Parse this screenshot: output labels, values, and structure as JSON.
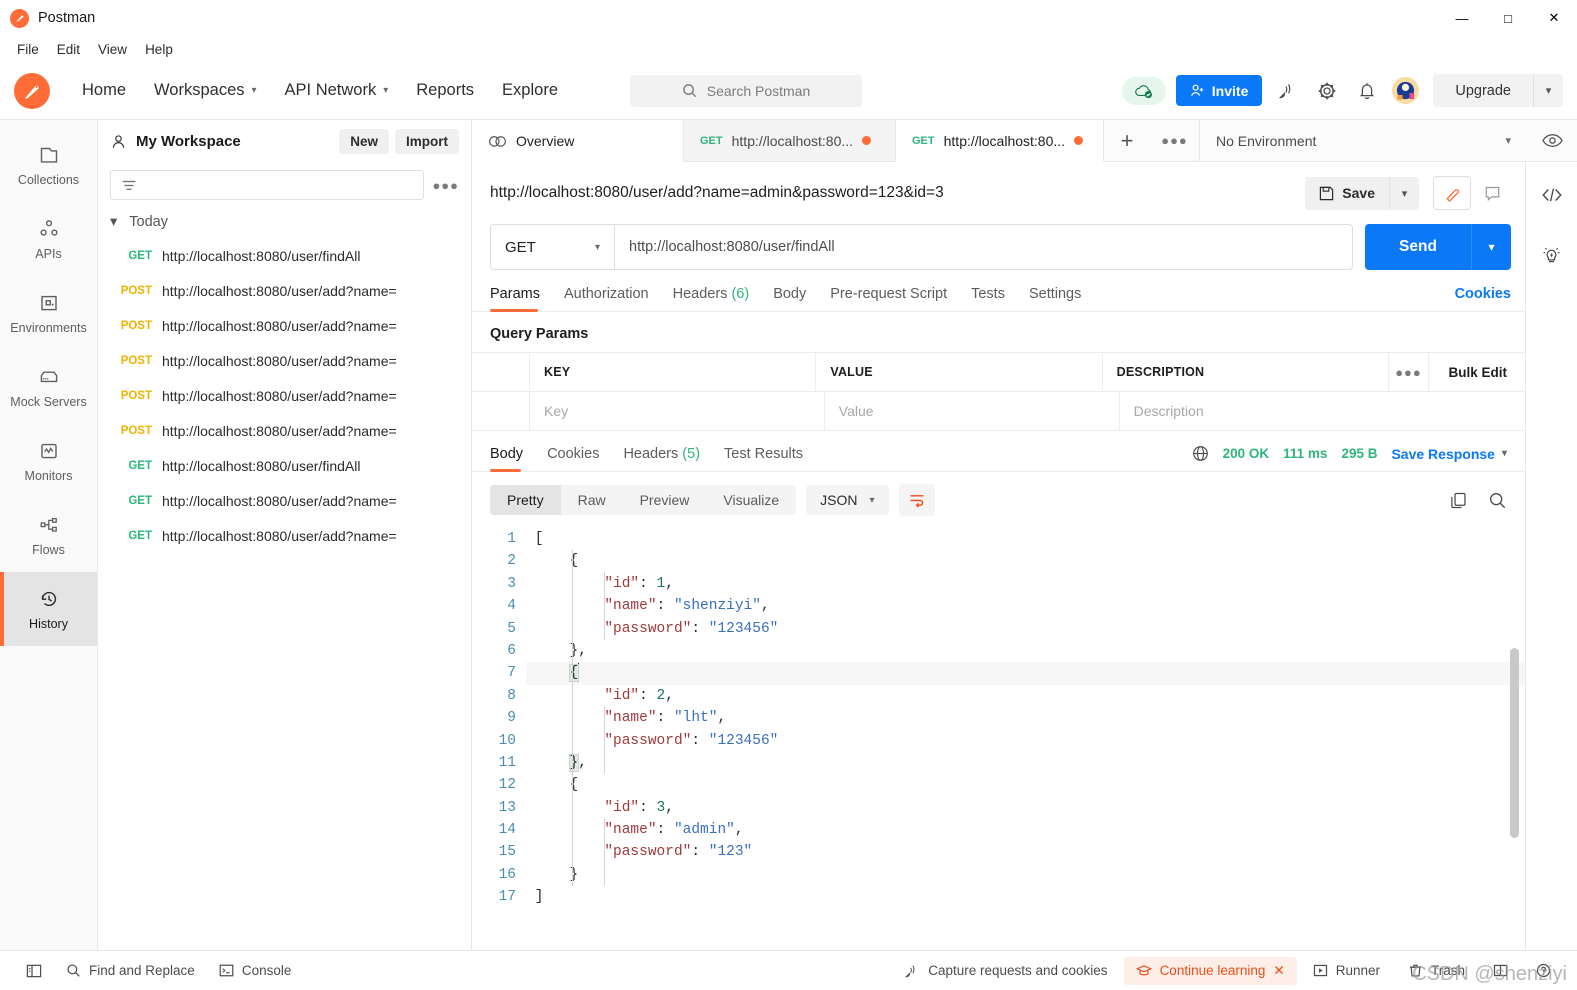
{
  "window": {
    "app_title": "Postman",
    "controls": {
      "minimize": "—",
      "maximize": "□",
      "close": "✕"
    }
  },
  "menubar": {
    "items": [
      "File",
      "Edit",
      "View",
      "Help"
    ]
  },
  "header": {
    "nav": [
      {
        "label": "Home",
        "has_caret": false
      },
      {
        "label": "Workspaces",
        "has_caret": true
      },
      {
        "label": "API Network",
        "has_caret": true
      },
      {
        "label": "Reports",
        "has_caret": false
      },
      {
        "label": "Explore",
        "has_caret": false
      }
    ],
    "search_placeholder": "Search Postman",
    "invite_label": "Invite",
    "upgrade_label": "Upgrade",
    "icons": [
      "cloud-sync-icon",
      "satellite-icon",
      "gear-icon",
      "bell-icon",
      "avatar"
    ]
  },
  "rail": {
    "items": [
      {
        "label": "Collections",
        "icon": "collections-icon",
        "active": false
      },
      {
        "label": "APIs",
        "icon": "apis-icon",
        "active": false
      },
      {
        "label": "Environments",
        "icon": "environments-icon",
        "active": false
      },
      {
        "label": "Mock Servers",
        "icon": "mock-servers-icon",
        "active": false
      },
      {
        "label": "Monitors",
        "icon": "monitors-icon",
        "active": false
      },
      {
        "label": "Flows",
        "icon": "flows-icon",
        "active": false
      },
      {
        "label": "History",
        "icon": "history-icon",
        "active": true
      }
    ]
  },
  "sidebar": {
    "workspace_name": "My Workspace",
    "new_label": "New",
    "import_label": "Import",
    "filter_placeholder": "",
    "group_label": "Today",
    "history": [
      {
        "method": "GET",
        "url": "http://localhost:8080/user/findAll"
      },
      {
        "method": "POST",
        "url": "http://localhost:8080/user/add?name="
      },
      {
        "method": "POST",
        "url": "http://localhost:8080/user/add?name="
      },
      {
        "method": "POST",
        "url": "http://localhost:8080/user/add?name="
      },
      {
        "method": "POST",
        "url": "http://localhost:8080/user/add?name="
      },
      {
        "method": "POST",
        "url": "http://localhost:8080/user/add?name="
      },
      {
        "method": "GET",
        "url": "http://localhost:8080/user/findAll"
      },
      {
        "method": "GET",
        "url": "http://localhost:8080/user/add?name="
      },
      {
        "method": "GET",
        "url": "http://localhost:8080/user/add?name="
      }
    ]
  },
  "tabbar": {
    "overview_label": "Overview",
    "tabs": [
      {
        "method": "GET",
        "name": "http://localhost:80...",
        "unsaved": true,
        "active": false
      },
      {
        "method": "GET",
        "name": "http://localhost:80...",
        "unsaved": true,
        "active": true
      }
    ],
    "environment": "No Environment"
  },
  "request": {
    "title": "http://localhost:8080/user/add?name=admin&password=123&id=3",
    "save_label": "Save",
    "method": "GET",
    "url": "http://localhost:8080/user/findAll",
    "send_label": "Send",
    "tabs": [
      {
        "label": "Params",
        "count": "",
        "active": true
      },
      {
        "label": "Authorization",
        "count": "",
        "active": false
      },
      {
        "label": "Headers",
        "count": "(6)",
        "active": false
      },
      {
        "label": "Body",
        "count": "",
        "active": false
      },
      {
        "label": "Pre-request Script",
        "count": "",
        "active": false
      },
      {
        "label": "Tests",
        "count": "",
        "active": false
      },
      {
        "label": "Settings",
        "count": "",
        "active": false
      }
    ],
    "cookies_label": "Cookies",
    "query_params_title": "Query Params",
    "params_table": {
      "headers": [
        "KEY",
        "VALUE",
        "DESCRIPTION"
      ],
      "bulk_edit_label": "Bulk Edit",
      "placeholders": [
        "Key",
        "Value",
        "Description"
      ]
    }
  },
  "response": {
    "tabs": [
      {
        "label": "Body",
        "count": "",
        "active": true
      },
      {
        "label": "Cookies",
        "count": "",
        "active": false
      },
      {
        "label": "Headers",
        "count": "(5)",
        "active": false
      },
      {
        "label": "Test Results",
        "count": "",
        "active": false
      }
    ],
    "status": "200 OK",
    "time": "111 ms",
    "size": "295 B",
    "save_response_label": "Save Response",
    "view_modes": [
      "Pretty",
      "Raw",
      "Preview",
      "Visualize"
    ],
    "active_view_mode": "Pretty",
    "format": "JSON",
    "body_lines": [
      {
        "n": 1,
        "indent": 0,
        "tokens": [
          {
            "t": "punc",
            "v": "["
          }
        ]
      },
      {
        "n": 2,
        "indent": 1,
        "tokens": [
          {
            "t": "brace",
            "v": "{"
          }
        ]
      },
      {
        "n": 3,
        "indent": 2,
        "tokens": [
          {
            "t": "key",
            "v": "\"id\""
          },
          {
            "t": "punc",
            "v": ": "
          },
          {
            "t": "num",
            "v": "1"
          },
          {
            "t": "punc",
            "v": ","
          }
        ]
      },
      {
        "n": 4,
        "indent": 2,
        "tokens": [
          {
            "t": "key",
            "v": "\"name\""
          },
          {
            "t": "punc",
            "v": ": "
          },
          {
            "t": "str",
            "v": "\"shenziyi\""
          },
          {
            "t": "punc",
            "v": ","
          }
        ]
      },
      {
        "n": 5,
        "indent": 2,
        "tokens": [
          {
            "t": "key",
            "v": "\"password\""
          },
          {
            "t": "punc",
            "v": ": "
          },
          {
            "t": "str",
            "v": "\"123456\""
          }
        ]
      },
      {
        "n": 6,
        "indent": 1,
        "tokens": [
          {
            "t": "brace",
            "v": "}"
          },
          {
            "t": "punc",
            "v": ","
          }
        ]
      },
      {
        "n": 7,
        "indent": 1,
        "tokens": [
          {
            "t": "brace-hl",
            "v": "{"
          },
          {
            "t": "caret",
            "v": ""
          }
        ]
      },
      {
        "n": 8,
        "indent": 2,
        "tokens": [
          {
            "t": "key",
            "v": "\"id\""
          },
          {
            "t": "punc",
            "v": ": "
          },
          {
            "t": "num",
            "v": "2"
          },
          {
            "t": "punc",
            "v": ","
          }
        ]
      },
      {
        "n": 9,
        "indent": 2,
        "tokens": [
          {
            "t": "key",
            "v": "\"name\""
          },
          {
            "t": "punc",
            "v": ": "
          },
          {
            "t": "str",
            "v": "\"lht\""
          },
          {
            "t": "punc",
            "v": ","
          }
        ]
      },
      {
        "n": 10,
        "indent": 2,
        "tokens": [
          {
            "t": "key",
            "v": "\"password\""
          },
          {
            "t": "punc",
            "v": ": "
          },
          {
            "t": "str",
            "v": "\"123456\""
          }
        ]
      },
      {
        "n": 11,
        "indent": 1,
        "tokens": [
          {
            "t": "brace-hl",
            "v": "}"
          },
          {
            "t": "punc",
            "v": ","
          }
        ]
      },
      {
        "n": 12,
        "indent": 1,
        "tokens": [
          {
            "t": "brace",
            "v": "{"
          }
        ]
      },
      {
        "n": 13,
        "indent": 2,
        "tokens": [
          {
            "t": "key",
            "v": "\"id\""
          },
          {
            "t": "punc",
            "v": ": "
          },
          {
            "t": "num",
            "v": "3"
          },
          {
            "t": "punc",
            "v": ","
          }
        ]
      },
      {
        "n": 14,
        "indent": 2,
        "tokens": [
          {
            "t": "key",
            "v": "\"name\""
          },
          {
            "t": "punc",
            "v": ": "
          },
          {
            "t": "str",
            "v": "\"admin\""
          },
          {
            "t": "punc",
            "v": ","
          }
        ]
      },
      {
        "n": 15,
        "indent": 2,
        "tokens": [
          {
            "t": "key",
            "v": "\"password\""
          },
          {
            "t": "punc",
            "v": ": "
          },
          {
            "t": "str",
            "v": "\"123\""
          }
        ]
      },
      {
        "n": 16,
        "indent": 1,
        "tokens": [
          {
            "t": "brace",
            "v": "}"
          }
        ]
      },
      {
        "n": 17,
        "indent": 0,
        "tokens": [
          {
            "t": "punc",
            "v": "]"
          }
        ]
      }
    ]
  },
  "footer": {
    "find_replace": "Find and Replace",
    "console": "Console",
    "capture": "Capture requests and cookies",
    "continue_learning": "Continue learning",
    "runner": "Runner",
    "trash": "Trash"
  },
  "watermark": "CSDN @shenziyi",
  "colors": {
    "accent_orange": "#ff6c37",
    "blue": "#0b79f7",
    "green": "#2eb67d",
    "yellow": "#f0b400"
  }
}
